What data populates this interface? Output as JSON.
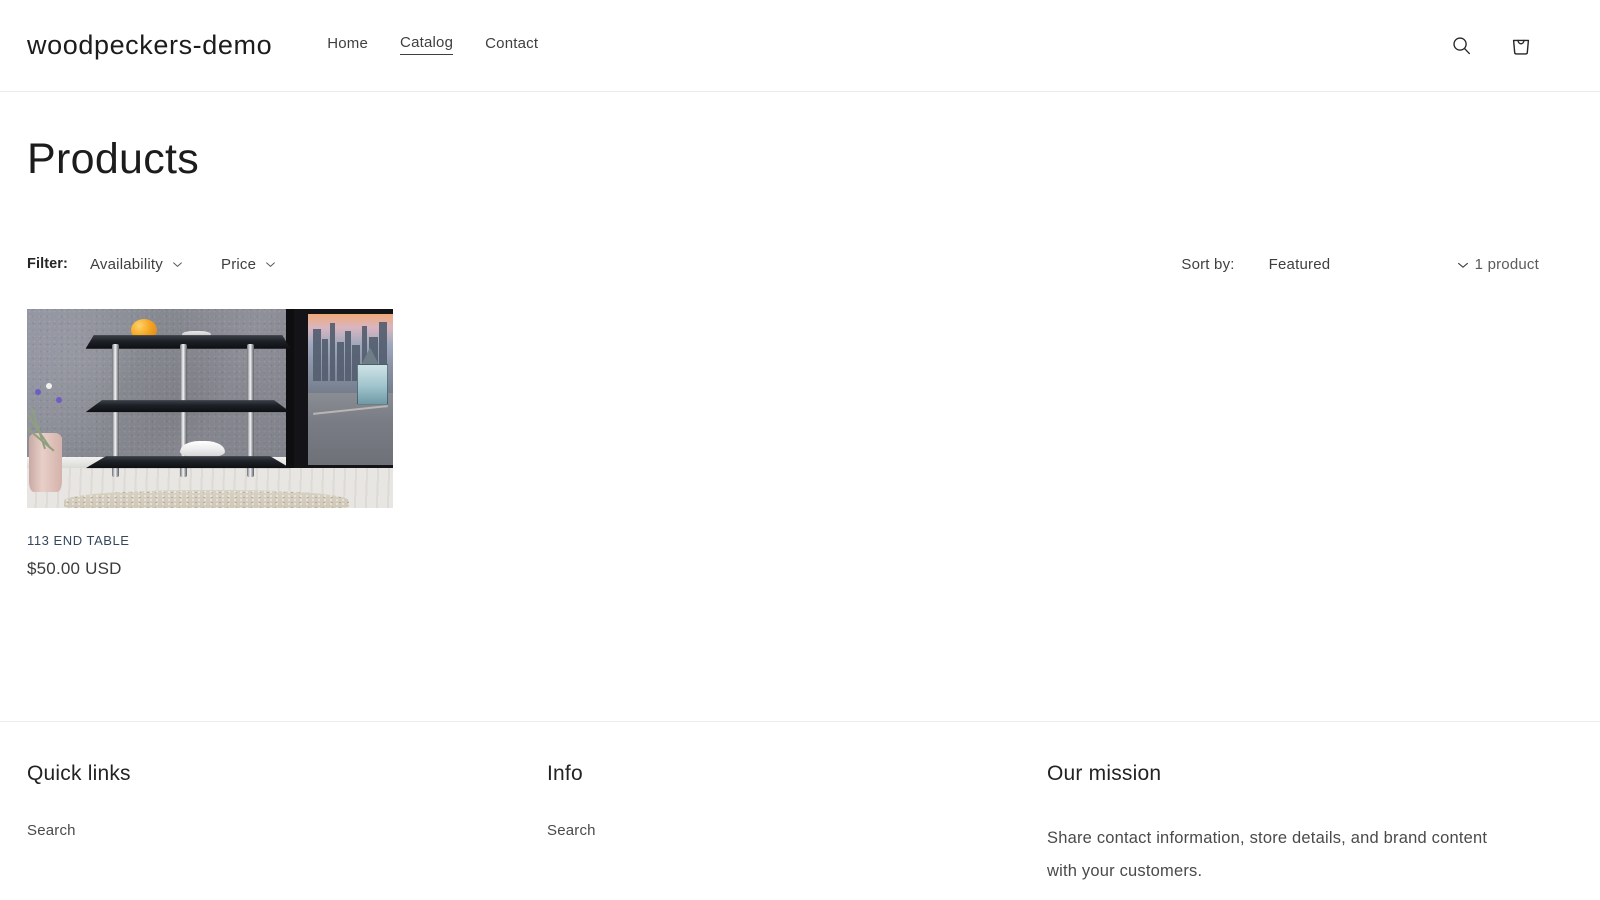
{
  "header": {
    "logo": "woodpeckers-demo",
    "nav": [
      {
        "label": "Home",
        "active": false
      },
      {
        "label": "Catalog",
        "active": true
      },
      {
        "label": "Contact",
        "active": false
      }
    ],
    "search_icon": "search-icon",
    "cart_icon": "shopping-bag-icon"
  },
  "page": {
    "title": "Products"
  },
  "toolbar": {
    "filter_label": "Filter:",
    "facets": [
      {
        "label": "Availability",
        "icon": "chevron-down-icon"
      },
      {
        "label": "Price",
        "icon": "chevron-down-icon"
      }
    ],
    "sort_label": "Sort by:",
    "sort_value": "Featured",
    "sort_icon": "chevron-down-icon",
    "product_count": "1 product"
  },
  "products": [
    {
      "title": "113 END TABLE",
      "price": "$50.00 USD",
      "image_alt": "113 End Table - black glass and chrome three-tier corner end table in a room"
    }
  ],
  "footer": {
    "columns": [
      {
        "title": "Quick links",
        "links": [
          "Search"
        ]
      },
      {
        "title": "Info",
        "links": [
          "Search"
        ]
      },
      {
        "title": "Our mission",
        "text": "Share contact information, store details, and brand content with your customers."
      }
    ]
  },
  "colors": {
    "text": "#1a1a1a",
    "muted": "#4a4a4a",
    "product_title": "#36485c",
    "divider": "#ececec",
    "background": "#ffffff"
  }
}
